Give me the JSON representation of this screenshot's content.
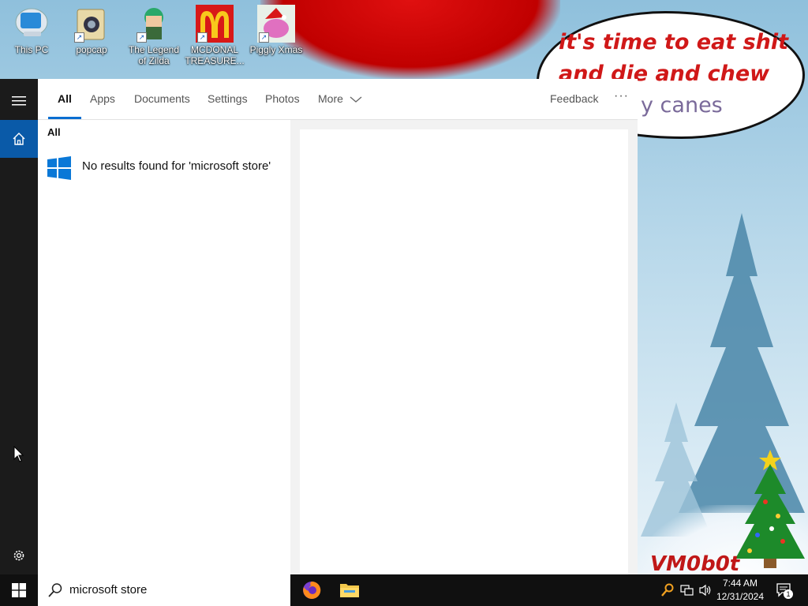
{
  "desktop": {
    "icons": [
      {
        "label": "This PC"
      },
      {
        "label": "popcap"
      },
      {
        "label": "The Legend of Zilda"
      },
      {
        "label": "MCDONAL TREASURE..."
      },
      {
        "label": "Piggly Xmas"
      }
    ]
  },
  "wallpaper": {
    "bubble_text": "it's time to eat shit and die and chew",
    "bubble_tail": "y canes",
    "signature": "VM0b0t"
  },
  "search": {
    "tabs": [
      {
        "label": "All"
      },
      {
        "label": "Apps"
      },
      {
        "label": "Documents"
      },
      {
        "label": "Settings"
      },
      {
        "label": "Photos"
      },
      {
        "label": "More"
      }
    ],
    "feedback_label": "Feedback",
    "more_options": "···",
    "section_title": "All",
    "no_results_text": "No results found for 'microsoft store'",
    "query": "microsoft store"
  },
  "taskbar": {
    "time": "7:44 AM",
    "date": "12/31/2024",
    "notification_count": "1"
  },
  "colors": {
    "accent": "#0a6ed1",
    "rail_active": "#0a5aa8",
    "taskbar": "#101010"
  }
}
